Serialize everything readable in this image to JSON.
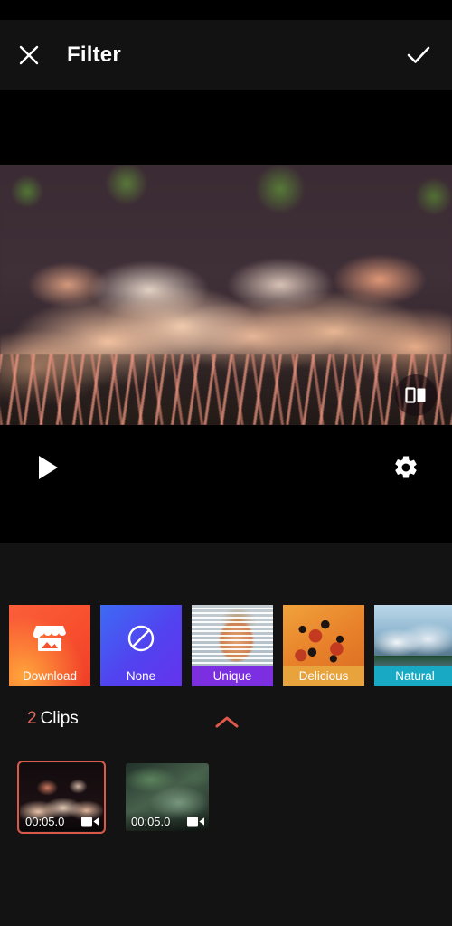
{
  "header": {
    "title": "Filter",
    "close_icon": "close-icon",
    "confirm_icon": "check-icon"
  },
  "preview": {
    "compare_icon": "compare-split-icon",
    "description": "flamingo flock video preview"
  },
  "transport": {
    "play_icon": "play-icon",
    "settings_icon": "gear-icon"
  },
  "filters": {
    "items": [
      {
        "label": "Download",
        "kind": "store",
        "icon": "storefront-icon",
        "label_bg": "transparent",
        "selected": false
      },
      {
        "label": "None",
        "kind": "none",
        "icon": "no-filter-icon",
        "label_bg": "transparent",
        "selected": false
      },
      {
        "label": "Unique",
        "kind": "preset",
        "icon": "",
        "label_bg": "#7b2fe0",
        "selected": false
      },
      {
        "label": "Delicious",
        "kind": "preset",
        "icon": "",
        "label_bg": "#e8a33d",
        "selected": false
      },
      {
        "label": "Natural",
        "kind": "preset",
        "icon": "",
        "label_bg": "#18aac4",
        "selected": false
      }
    ]
  },
  "clips_section": {
    "count": "2",
    "label": "Clips",
    "collapse_icon": "chevron-up-icon",
    "accent_color": "#e8685c",
    "clips": [
      {
        "duration": "00:05.0",
        "type_icon": "video-camera-icon",
        "selected": true
      },
      {
        "duration": "00:05.0",
        "type_icon": "video-camera-icon",
        "selected": false
      }
    ]
  }
}
